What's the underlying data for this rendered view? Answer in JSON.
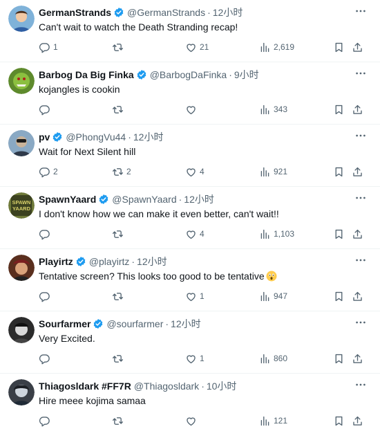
{
  "colors": {
    "text": "#0f1419",
    "secondary": "#536471",
    "verified": "#1d9bf0",
    "divider": "#eff3f4"
  },
  "icons": {
    "reply": "speech-bubble-icon",
    "retweet": "retweet-arrows-icon",
    "like": "heart-icon",
    "views": "bar-chart-icon",
    "bookmark": "bookmark-icon",
    "share": "share-upload-icon",
    "more": "more-dots-icon",
    "verified": "verified-badge-icon"
  },
  "tweets": [
    {
      "name": "GermanStrands",
      "handle": "@GermanStrands",
      "dot": "·",
      "time": "12小时",
      "text": "Can't wait to watch the Death Stranding recap!",
      "reply_count": "1",
      "retweet_count": "",
      "like_count": "21",
      "view_count": "2,619",
      "avatar_color": "#7fb2d9"
    },
    {
      "name": "Barbog Da Big Finka",
      "handle": "@BarbogDaFinka",
      "dot": "·",
      "time": "9小时",
      "text": "kojangles is cookin",
      "reply_count": "",
      "retweet_count": "",
      "like_count": "",
      "view_count": "343",
      "avatar_color": "#5e8a2c"
    },
    {
      "name": "pv",
      "handle": "@PhongVu44",
      "dot": "·",
      "time": "12小时",
      "text": "Wait for Next Silent hill",
      "reply_count": "2",
      "retweet_count": "2",
      "like_count": "4",
      "view_count": "921",
      "avatar_color": "#4a6c8c"
    },
    {
      "name": "SpawnYaard",
      "handle": "@SpawnYaard",
      "dot": "·",
      "time": "12小时",
      "text": "I don't know how we can make it even better, can't wait!!",
      "reply_count": "",
      "retweet_count": "",
      "like_count": "4",
      "view_count": "1,103",
      "avatar_color": "#6f7a3a",
      "avatar_text_1": "SPAWN",
      "avatar_text_2": "YAARD"
    },
    {
      "name": "Playirtz",
      "handle": "@playirtz",
      "dot": "·",
      "time": "12小时",
      "text": "Tentative screen? This looks too good to be tentative",
      "reply_count": "",
      "retweet_count": "",
      "like_count": "1",
      "view_count": "947",
      "avatar_color": "#5a2f1e",
      "emoji": "astonished-face-emoji"
    },
    {
      "name": "Sourfarmer",
      "handle": "@sourfarmer",
      "dot": "·",
      "time": "12小时",
      "text": "Very Excited.",
      "reply_count": "",
      "retweet_count": "",
      "like_count": "1",
      "view_count": "860",
      "avatar_color": "#2b2b2b"
    },
    {
      "name": "Thiagosldark #FF7R",
      "handle": "@Thiagosldark",
      "dot": "·",
      "time": "10小时",
      "text": "Hire meee kojima samaa",
      "reply_count": "",
      "retweet_count": "",
      "like_count": "",
      "view_count": "121",
      "avatar_color": "#3a3f47",
      "has_verified": false
    }
  ]
}
